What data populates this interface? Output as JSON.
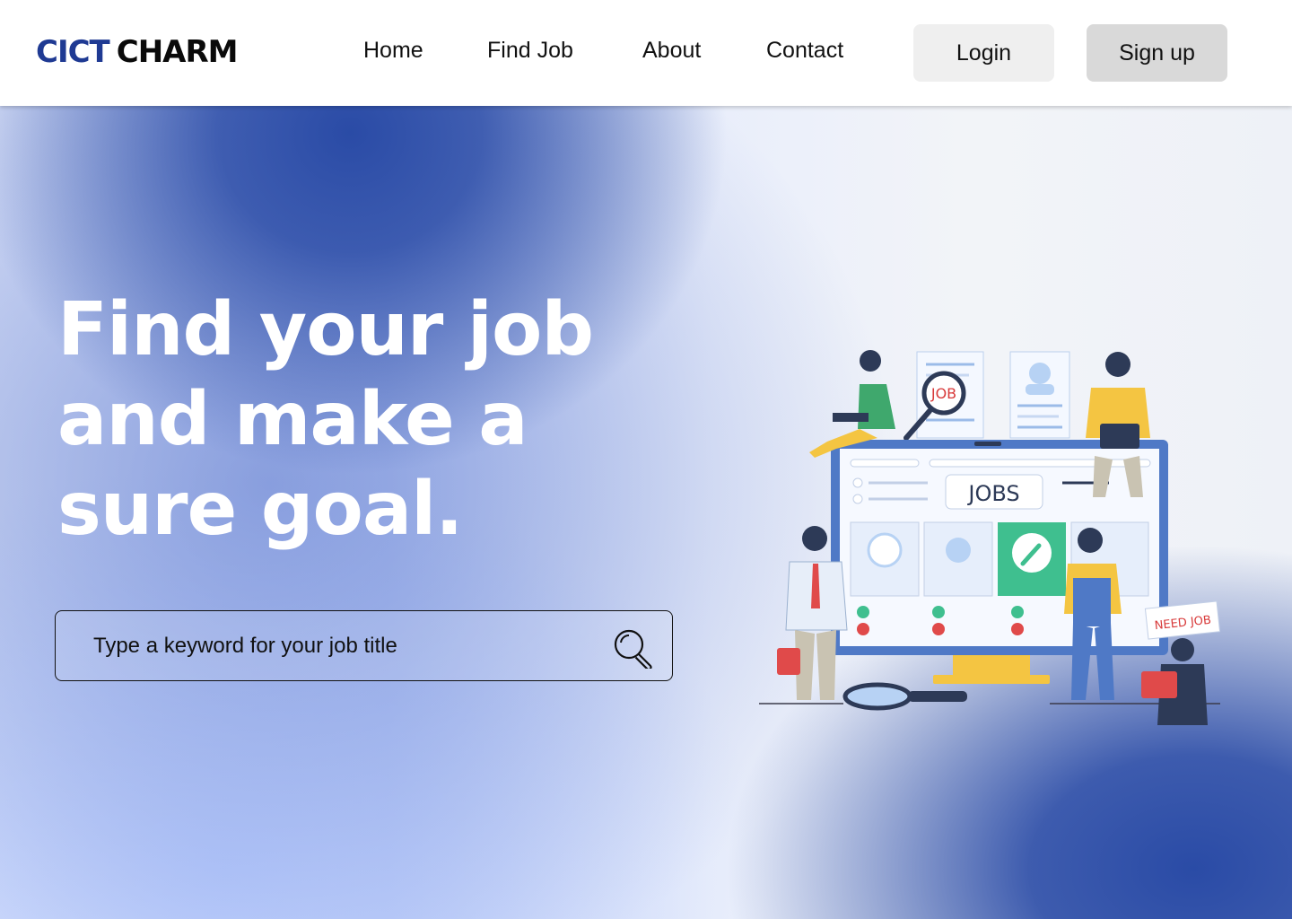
{
  "brand": {
    "part1": "CICT",
    "part2": "CHARM",
    "color_part1": "#1f3a93",
    "color_part2": "#0a0a0a"
  },
  "nav": {
    "home": "Home",
    "find_job": "Find Job",
    "about": "About",
    "contact": "Contact"
  },
  "auth": {
    "login": "Login",
    "signup": "Sign up"
  },
  "hero": {
    "headline_lines": [
      "Find your job",
      "and make a",
      "sure goal."
    ],
    "search": {
      "placeholder": "Type a keyword for your job title",
      "icon": "magnifier-icon"
    }
  },
  "illustration": {
    "screen_label": "JOBS",
    "magnifier_label": "JOB",
    "sign_label": "NEED JOB"
  },
  "colors": {
    "accent": "#2a4ba6",
    "button_login": "#efefef",
    "button_signup": "#d9d9d9"
  }
}
